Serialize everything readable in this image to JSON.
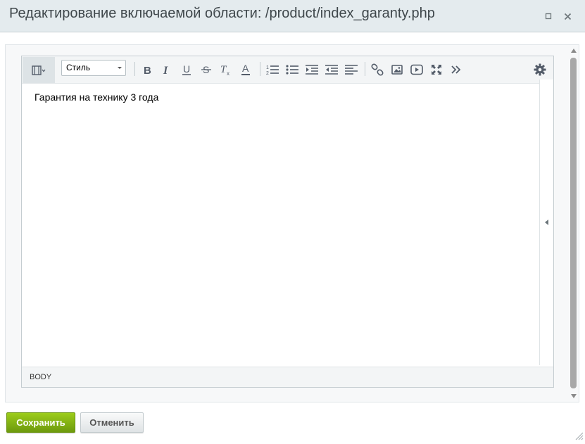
{
  "dialog": {
    "title": "Редактирование включаемой области: /product/index_garanty.php"
  },
  "toolbar": {
    "style_select_value": "Стиль",
    "buttons": [
      {
        "icon": "view-mode-icon"
      },
      {
        "icon": "bold-icon"
      },
      {
        "icon": "italic-icon"
      },
      {
        "icon": "underline-icon"
      },
      {
        "icon": "strikethrough-icon"
      },
      {
        "icon": "remove-format-icon"
      },
      {
        "icon": "text-color-icon"
      },
      {
        "icon": "ordered-list-icon"
      },
      {
        "icon": "unordered-list-icon"
      },
      {
        "icon": "indent-icon"
      },
      {
        "icon": "outdent-icon"
      },
      {
        "icon": "align-icon"
      },
      {
        "icon": "link-icon"
      },
      {
        "icon": "image-icon"
      },
      {
        "icon": "video-icon"
      },
      {
        "icon": "fullscreen-icon"
      },
      {
        "icon": "more-icon"
      },
      {
        "icon": "settings-icon"
      }
    ]
  },
  "editor": {
    "content": "Гарантия на технику 3 года",
    "status_tag": "BODY"
  },
  "footer": {
    "save_label": "Сохранить",
    "cancel_label": "Отменить"
  },
  "colors": {
    "titlebar_bg": "#e4ebee",
    "save_button": "#87b816",
    "icon": "#535c69"
  }
}
